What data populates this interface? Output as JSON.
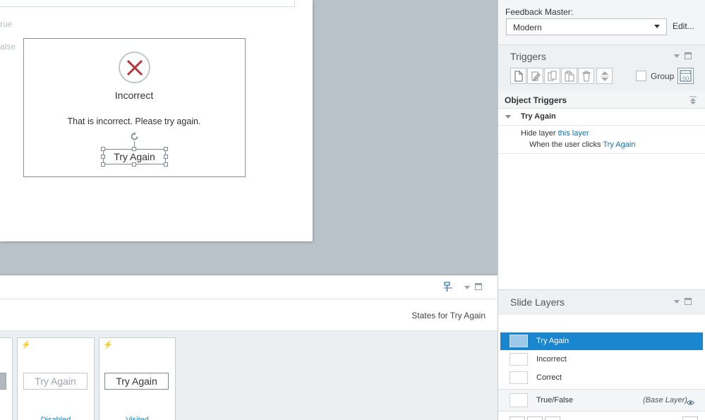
{
  "canvas": {
    "ghost_option_1": "rue",
    "ghost_option_2": "alse",
    "feedback_title": "Incorrect",
    "feedback_message": "That is incorrect. Please try again.",
    "button_label": "Try Again"
  },
  "states_panel": {
    "states_for_label": "States for Try Again",
    "states": [
      {
        "button_label": "Try Again",
        "name": "Disabled"
      },
      {
        "button_label": "Try Again",
        "name": "Visited"
      }
    ]
  },
  "feedback_master": {
    "label": "Feedback Master:",
    "value": "Modern",
    "edit_label": "Edit..."
  },
  "triggers": {
    "title": "Triggers",
    "group_label": "Group",
    "object_triggers_label": "Object Triggers",
    "object_name": "Try Again",
    "action_verb": "Hide layer",
    "action_target": "this layer",
    "when_prefix": "When the",
    "when_user": "user",
    "when_verb": "clicks",
    "when_object": "Try Again"
  },
  "slide_layers": {
    "title": "Slide Layers",
    "layers": [
      {
        "name": "Try Again",
        "selected": true
      },
      {
        "name": "Incorrect",
        "selected": false
      },
      {
        "name": "Correct",
        "selected": false
      }
    ],
    "base_layer_name": "True/False",
    "base_layer_tag": "(Base Layer)"
  },
  "colors": {
    "accent": "#1a86d0",
    "link": "#1a6fb2",
    "x_mark": "#b3343a",
    "canvas_bg": "#b9c2c9"
  },
  "icons": [
    "x-mark-icon",
    "rotate-handle-icon",
    "lightning-icon",
    "new-trigger-icon",
    "edit-trigger-icon",
    "copy-trigger-icon",
    "paste-trigger-icon",
    "delete-trigger-icon",
    "move-trigger-icon",
    "variables-icon",
    "eye-icon",
    "chevron-down-icon",
    "restore-panel-icon"
  ]
}
